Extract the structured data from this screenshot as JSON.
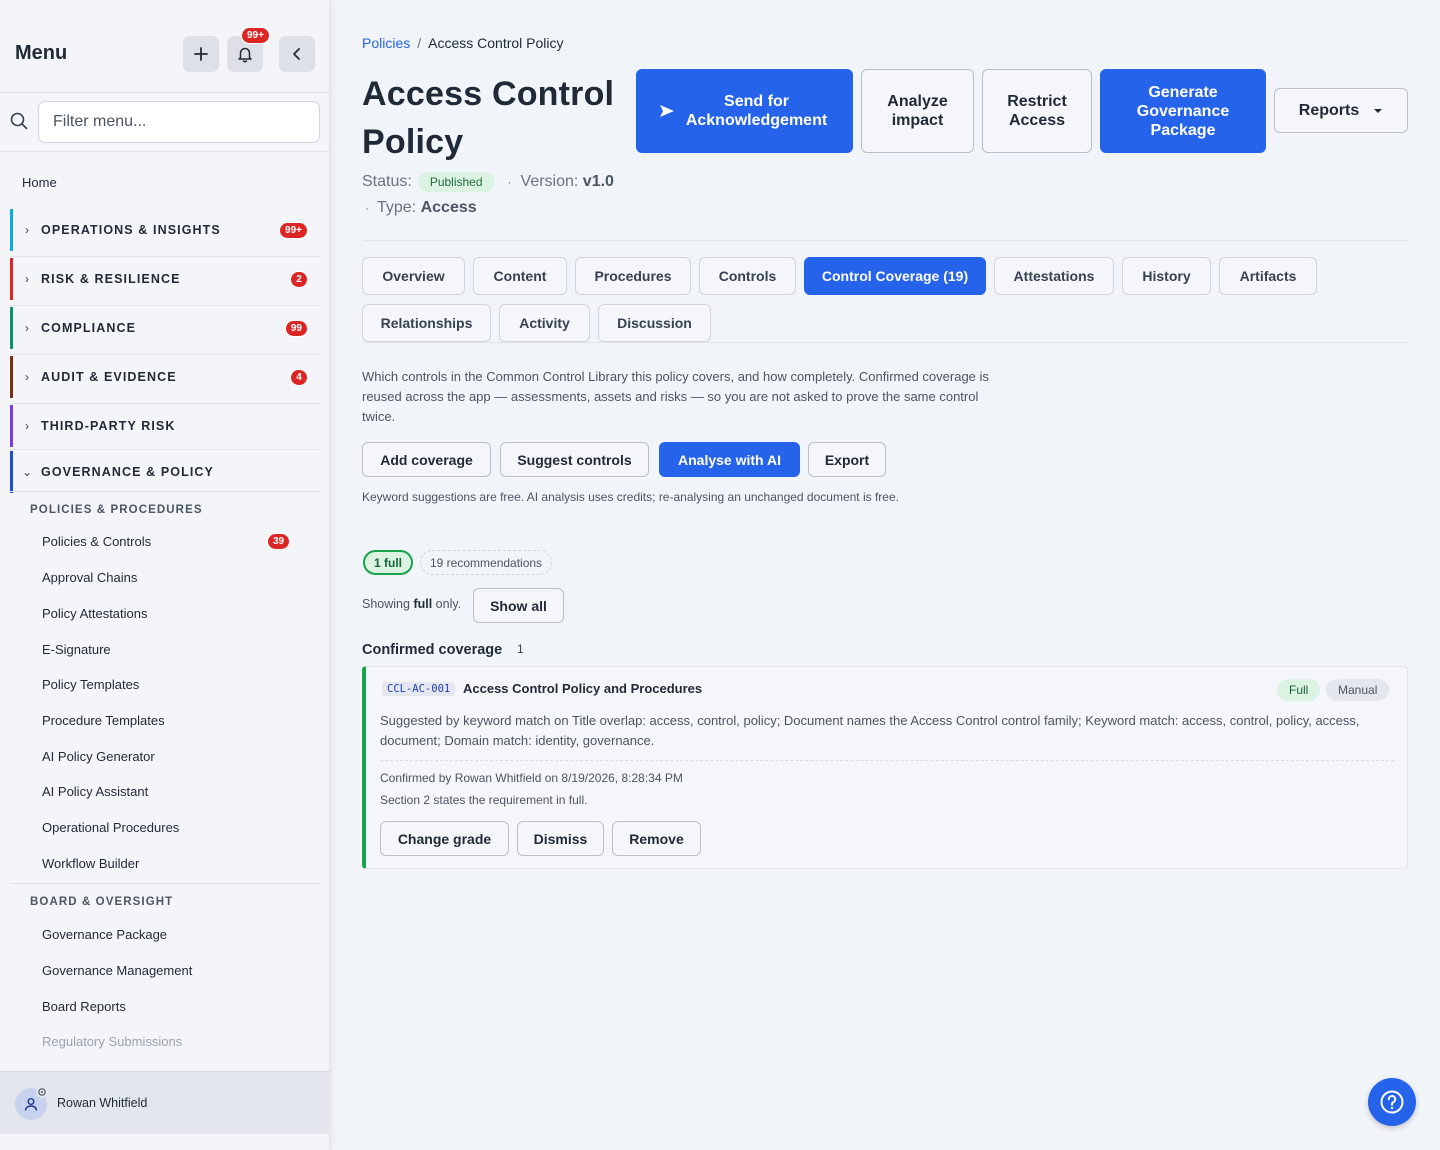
{
  "sidebar": {
    "title": "Menu",
    "notif_badge": "99+",
    "filter_placeholder": "Filter menu...",
    "home": "Home",
    "groups": [
      {
        "label": "OPERATIONS & INSIGHTS",
        "badge": "99+",
        "color": "#0ea5e9"
      },
      {
        "label": "RISK & RESILIENCE",
        "badge": "2",
        "color": "#dc2626"
      },
      {
        "label": "COMPLIANCE",
        "badge": "99",
        "color": "#059669"
      },
      {
        "label": "AUDIT & EVIDENCE",
        "badge": "4",
        "color": "#7c2d12"
      },
      {
        "label": "THIRD-PARTY RISK",
        "badge": "",
        "color": "#7c3aed"
      },
      {
        "label": "GOVERNANCE & POLICY",
        "badge": "",
        "color": "#1d4ed8"
      }
    ],
    "section1": "POLICIES & PROCEDURES",
    "section1_items": [
      {
        "label": "Policies & Controls",
        "badge": "39"
      },
      {
        "label": "Approval Chains"
      },
      {
        "label": "Policy Attestations"
      },
      {
        "label": "E-Signature"
      },
      {
        "label": "Policy Templates"
      },
      {
        "label": "Procedure Templates"
      },
      {
        "label": "AI Policy Generator"
      },
      {
        "label": "AI Policy Assistant"
      },
      {
        "label": "Operational Procedures"
      },
      {
        "label": "Workflow Builder"
      }
    ],
    "section2": "BOARD & OVERSIGHT",
    "section2_items": [
      {
        "label": "Governance Package"
      },
      {
        "label": "Governance Management"
      },
      {
        "label": "Board Reports"
      },
      {
        "label": "Regulatory Submissions"
      }
    ],
    "user": "Rowan Whitfield"
  },
  "header": {
    "breadcrumb_link": "Policies",
    "breadcrumb_sep": "/",
    "breadcrumb_current": "Access Control Policy",
    "title": "Access Control Policy",
    "status_label": "Status:",
    "status_value": "Published",
    "version_label": "Version:",
    "version_value": "v1.0",
    "type_label": "Type:",
    "type_value": "Access",
    "buttons": {
      "send": "Send for Acknowledgement",
      "analyze": "Analyze impact",
      "restrict": "Restrict Access",
      "generate": "Generate Governance Package",
      "reports": "Reports"
    }
  },
  "tabs": [
    {
      "label": "Overview"
    },
    {
      "label": "Content"
    },
    {
      "label": "Procedures"
    },
    {
      "label": "Controls"
    },
    {
      "label": "Control Coverage (19)",
      "active": true
    },
    {
      "label": "Attestations"
    },
    {
      "label": "History"
    },
    {
      "label": "Artifacts"
    },
    {
      "label": "Relationships"
    },
    {
      "label": "Activity"
    },
    {
      "label": "Discussion"
    }
  ],
  "coverage": {
    "description": "Which controls in the Common Control Library this policy covers, and how completely. Confirmed coverage is reused across the app — assessments, assets and risks — so you are not asked to prove the same control twice.",
    "actions": {
      "add": "Add coverage",
      "suggest": "Suggest controls",
      "analyse": "Analyse with AI",
      "export": "Export"
    },
    "note": "Keyword suggestions are free. AI analysis uses credits; re-analysing an unchanged document is free.",
    "chip_full": "1 full",
    "chip_recommendations": "19 recommendations",
    "showing_prefix": "Showing",
    "showing_bold": "full",
    "showing_suffix": "only.",
    "show_all": "Show all",
    "confirmed_title": "Confirmed coverage",
    "confirmed_count": "1",
    "item": {
      "code": "CCL-AC-001",
      "name": "Access Control Policy and Procedures",
      "grade": "Full",
      "source": "Manual",
      "suggestion": "Suggested by keyword match on Title overlap: access, control, policy; Document names the Access Control control family; Keyword match: access, control, policy, access, document; Domain match: identity, governance.",
      "confirmed_by": "Confirmed by Rowan Whitfield on 8/19/2026, 8:28:34 PM",
      "section_note": "Section 2 states the requirement in full.",
      "buttons": {
        "change": "Change grade",
        "dismiss": "Dismiss",
        "remove": "Remove"
      }
    }
  },
  "icons": {
    "add": "plus-icon",
    "bell": "bell-icon",
    "collapse": "chevron-left-icon",
    "search": "search-icon",
    "send": "send-icon",
    "caret": "caret-down-icon",
    "help": "help-icon",
    "user": "user-icon"
  },
  "colors": {
    "primary": "#2563eb",
    "badge": "#dc2626",
    "success": "#16a34a"
  }
}
